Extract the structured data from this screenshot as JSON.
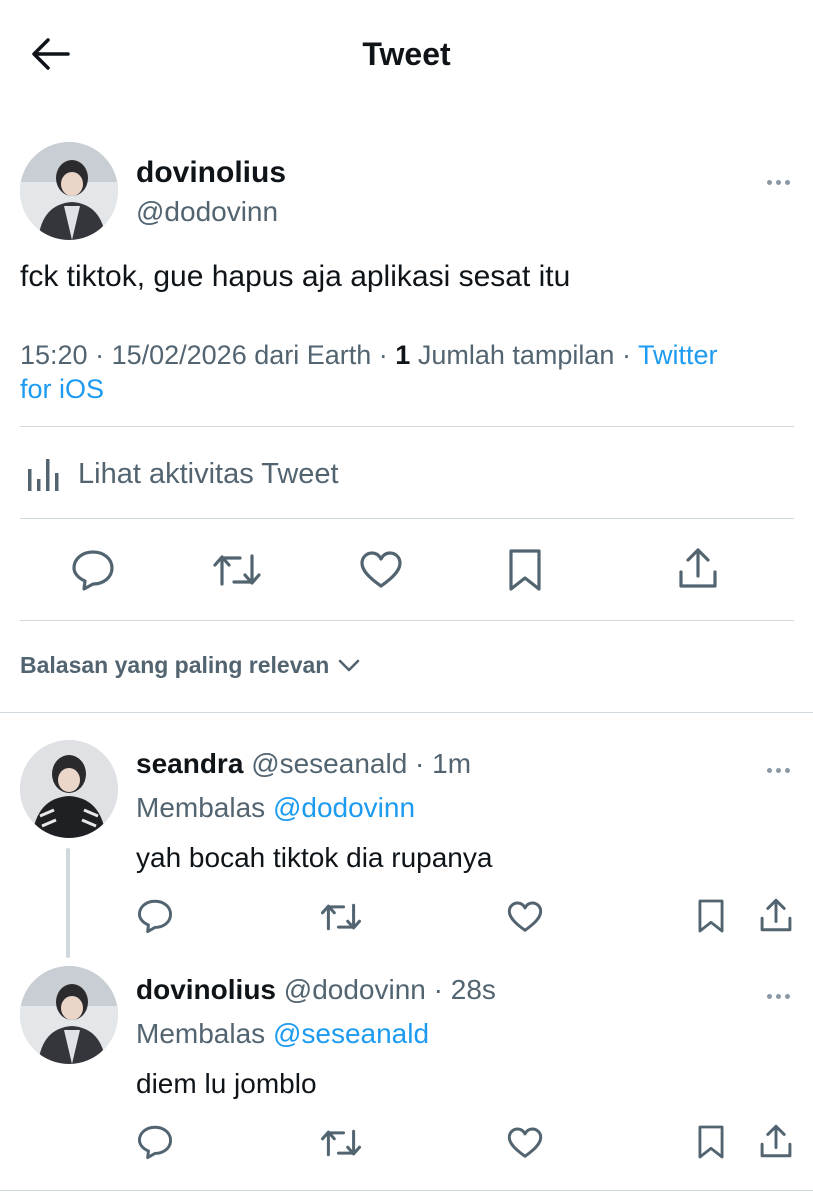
{
  "header": {
    "title": "Tweet"
  },
  "main_tweet": {
    "name": "dovinolius",
    "handle": "@dodovinn",
    "text": "fck tiktok, gue hapus aja aplikasi sesat itu",
    "meta": {
      "time": "15:20",
      "date": "15/02/2026",
      "location_text": "dari Earth",
      "views_count": "1",
      "views_label": "Jumlah tampilan",
      "source_line1": "Twitter",
      "source_line2": "for iOS"
    },
    "activity_label": "Lihat aktivitas Tweet"
  },
  "sort": {
    "label": "Balasan yang paling relevan"
  },
  "replies": [
    {
      "name": "seandra",
      "handle": "@seseanald",
      "time": "1m",
      "replying_label": "Membalas",
      "replying_to": "@dodovinn",
      "text": "yah bocah tiktok dia rupanya"
    },
    {
      "name": "dovinolius",
      "handle": "@dodovinn",
      "time": "28s",
      "replying_label": "Membalas",
      "replying_to": "@seseanald",
      "text": "diem lu jomblo"
    }
  ],
  "icons": {
    "back": "arrow-left-icon",
    "reply": "speech-bubble-icon",
    "retweet": "retweet-icon",
    "like": "heart-icon",
    "bookmark": "bookmark-icon",
    "share": "share-upload-icon",
    "analytics": "bar-chart-icon",
    "more": "more-dots-icon"
  },
  "colors": {
    "accent": "#1d9bf0",
    "muted": "#536471",
    "text": "#0f1419",
    "divider": "#cfd9de"
  }
}
